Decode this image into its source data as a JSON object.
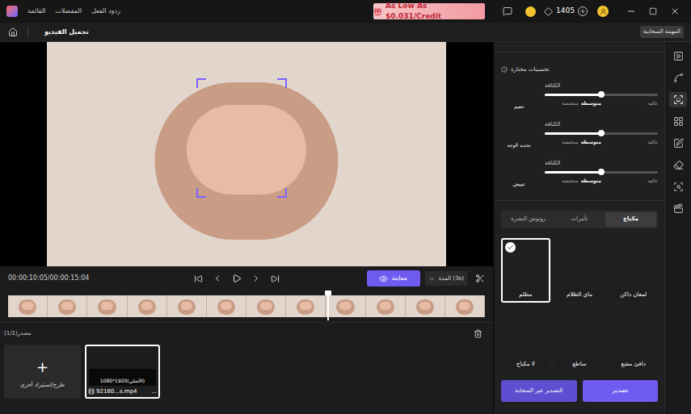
{
  "title_bar": {
    "menus": [
      "القائمة",
      "المفضلات",
      "ردود الفعل"
    ],
    "promo": "As Low As $0.031/Credit",
    "credits": "1405"
  },
  "toolbar": {
    "title": "تجميل الفيديو",
    "cloud_task": "المهمة السحابية"
  },
  "player": {
    "time": "00:00:10:05/00:00:15:04",
    "preview_button": "معاينة",
    "duration": "المدة (3s)",
    "progress": 0.67
  },
  "media": {
    "heading": "مصدر(1/1)",
    "plus": "+",
    "import_label": "طرح/استيراد أخرى",
    "clips": [
      {
        "resolution": "1080*1920(الأصلي)",
        "filename": "92180...s.mp4",
        "more": "...",
        "selected": true
      }
    ]
  },
  "enhancements": {
    "heading": "تحسينات مختارة",
    "rows": [
      {
        "name": "تنعيم",
        "label": "الكثافة",
        "level": 0.5,
        "marks": [
          {
            "text": "منخفضة",
            "selected": false
          },
          {
            "text": "متوسطة",
            "selected": true
          },
          {
            "text": "عالية",
            "selected": false
          }
        ]
      },
      {
        "name": "تحديد الوجه",
        "label": "الكثافة",
        "level": 0.5,
        "marks": [
          {
            "text": "منخفضة",
            "selected": false
          },
          {
            "text": "متوسطة",
            "selected": true
          },
          {
            "text": "عالية",
            "selected": false
          }
        ]
      },
      {
        "name": "تبييض",
        "label": "الكثافة",
        "level": 0.5,
        "marks": [
          {
            "text": "منخفضة",
            "selected": false
          },
          {
            "text": "متوسطة",
            "selected": true
          },
          {
            "text": "عالية",
            "selected": false
          }
        ]
      }
    ]
  },
  "tabs": [
    {
      "label": "مكياج",
      "selected": true
    },
    {
      "label": "تأثيرات",
      "selected": false
    },
    {
      "label": "روتوش البشرة",
      "selected": false
    }
  ],
  "presets": [
    {
      "name": "لمعان داكن",
      "selected": false
    },
    {
      "name": "ماي الظلام",
      "selected": false
    },
    {
      "name": "مظلم",
      "selected": true
    },
    {
      "name": "دافئ مشع",
      "selected": false
    },
    {
      "name": "ساطع",
      "selected": false
    },
    {
      "name": "لا مكياج",
      "selected": false
    }
  ],
  "buttons": {
    "export": "تصدير",
    "cloud_export": "التصدير عبر السحابة"
  },
  "sidebar": [
    {
      "selected": false
    },
    {
      "selected": false
    },
    {
      "selected": true
    },
    {
      "selected": false
    },
    {
      "selected": false
    },
    {
      "selected": false
    },
    {
      "selected": false
    },
    {
      "selected": false
    }
  ]
}
